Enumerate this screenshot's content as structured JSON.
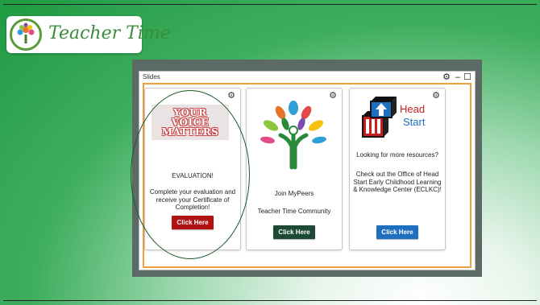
{
  "logo": {
    "text": "Teacher Time"
  },
  "window": {
    "title": "Slides",
    "controls": {
      "gear": "⚙",
      "minimize": "–",
      "maximize": "☐"
    }
  },
  "cards": [
    {
      "image_text": "YOUR VOICE MATTERS",
      "heading": "EVALUATION!",
      "body": "Complete your evaluation and receive your Certificate of Completion!",
      "button": "Click Here",
      "button_color": "#b01111"
    },
    {
      "line1": "Join MyPeers",
      "line2": "Teacher Time Community",
      "button": "Click Here",
      "button_color": "#1d4a35"
    },
    {
      "logo_word1": "Head",
      "logo_word2": "Start",
      "line1": "Looking for more resources?",
      "line2": "Check out the Office of Head Start Early Childhood Learning & Knowledge Center (ECLKC)!",
      "button": "Click Here",
      "button_color": "#1f6fc0"
    }
  ],
  "colors": {
    "accent_border": "#f0a040",
    "background_green": "#1f9a43",
    "oval_outline": "#1e5a28"
  }
}
